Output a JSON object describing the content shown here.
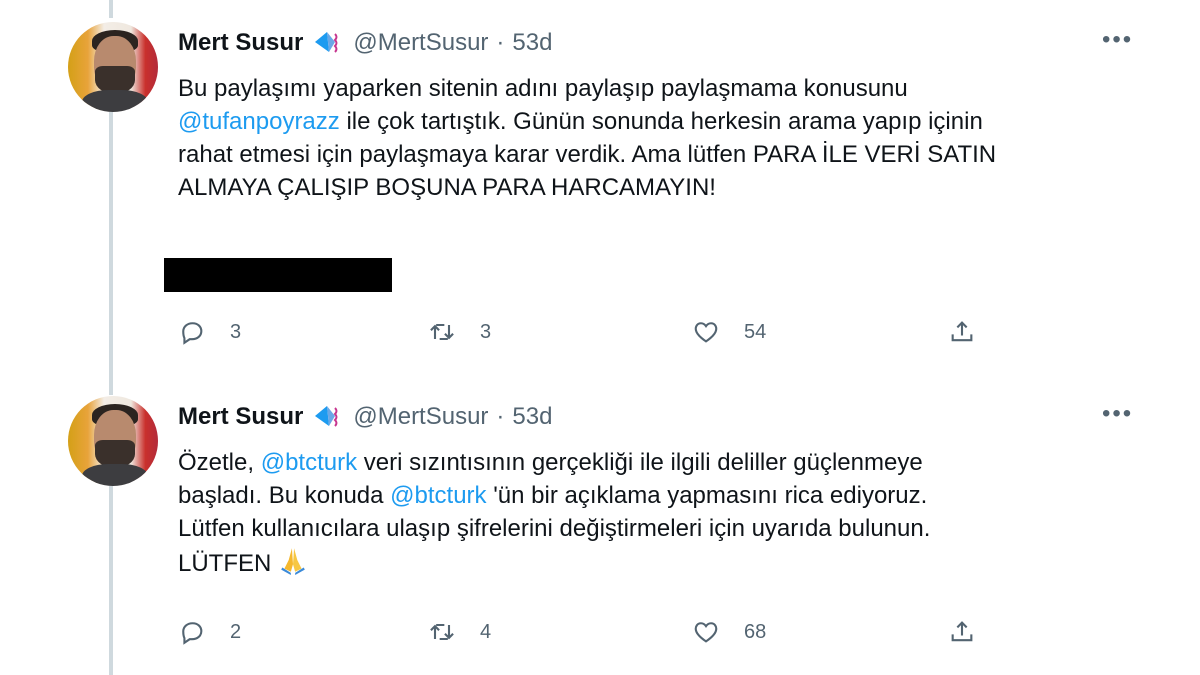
{
  "tweets": [
    {
      "author_name": "Mert Susur",
      "handle": "@MertSusur",
      "separator": "·",
      "time": "53d",
      "more": "•••",
      "text": {
        "line1": "Bu paylaşımı yaparken sitenin adını paylaşıp paylaşmama konusunu",
        "mention": "@tufanpoyrazz",
        "line2_rest": " ile çok tartıştık. Günün sonunda herkesin arama yapıp içinin",
        "line3": "rahat etmesi için paylaşmaya karar verdik. Ama lütfen PARA İLE VERİ SATIN",
        "line4": "ALMAYA ÇALIŞIP BOŞUNA PARA HARCAMAYIN!"
      },
      "replies": "3",
      "retweets": "3",
      "likes": "54"
    },
    {
      "author_name": "Mert Susur",
      "handle": "@MertSusur",
      "separator": "·",
      "time": "53d",
      "more": "•••",
      "text": {
        "l1_a": "Özetle, ",
        "l1_mention": "@btcturk",
        "l1_b": " veri sızıntısının gerçekliği ile ilgili deliller güçlenmeye",
        "l2_a": "başladı. Bu konuda ",
        "l2_mention": "@btcturk",
        "l2_b": " 'ün bir açıklama yapmasını rica ediyoruz.",
        "l3": "Lütfen kullanıcılara ulaşıp şifrelerini değiştirmeleri için uyarıda bulunun.",
        "l4": "LÜTFEN "
      },
      "replies": "2",
      "retweets": "4",
      "likes": "68"
    }
  ],
  "icons": {
    "badge": "kite-icon",
    "reply": "reply-icon",
    "retweet": "retweet-icon",
    "like": "heart-icon",
    "share": "share-icon",
    "emoji": "folded-hands-icon"
  },
  "colors": {
    "link": "#1d9bf0",
    "secondary_text": "#536471",
    "thread_line": "#cfd9de"
  }
}
